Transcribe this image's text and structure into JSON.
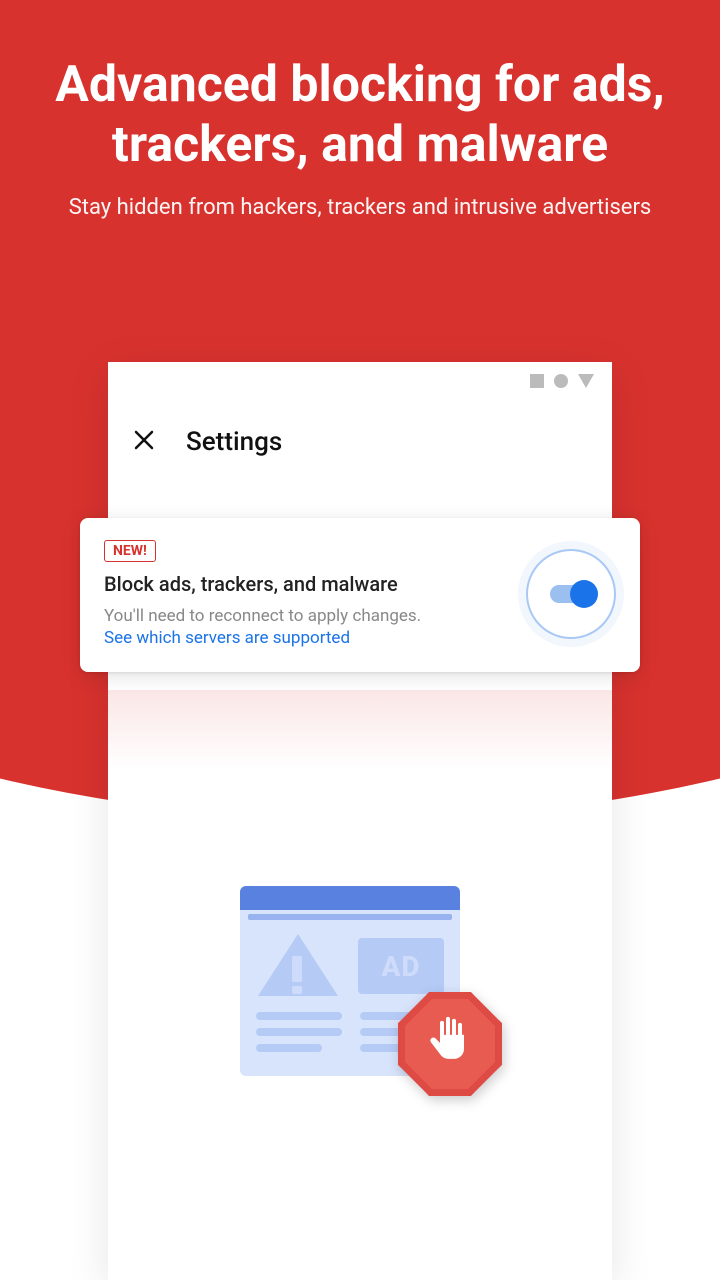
{
  "hero": {
    "title": "Advanced blocking for ads, trackers, and malware",
    "subtitle": "Stay hidden from hackers, trackers and intrusive advertisers"
  },
  "phone": {
    "header_title": "Settings"
  },
  "card": {
    "badge": "NEW!",
    "title": "Block ads, trackers, and malware",
    "description": "You'll need to reconnect to apply changes.",
    "link": "See which servers are supported"
  },
  "illustration": {
    "ad_label": "AD"
  }
}
